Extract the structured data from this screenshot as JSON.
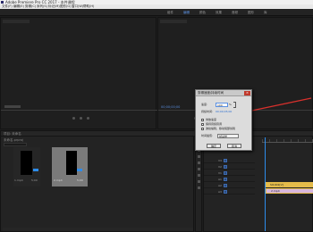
{
  "window": {
    "title": "Adobe Premiere Pro CC 2017 - 本件课程"
  },
  "menu": [
    "文件(F)",
    "编辑(E)",
    "剪辑(C)",
    "序列(S)",
    "标记(M)",
    "图形(G)",
    "窗口(W)",
    "帮助(H)"
  ],
  "workspaces": [
    "组件",
    "编辑",
    "颜色",
    "效果",
    "音频",
    "图形",
    "库"
  ],
  "program_monitor": {
    "timecode": "00;00;00;00"
  },
  "project_panel": {
    "tab_label": "项目: 未命名",
    "file_label": "未命名.prproj",
    "search_placeholder": "",
    "items": [
      {
        "name": "1.mp4",
        "duration": "5;00"
      },
      {
        "name": "2.mp4",
        "duration": "5;00"
      }
    ]
  },
  "timeline": {
    "timecode": "00;00;00;00",
    "clip_labels": [
      "SI1001[V]",
      "2.mp4"
    ],
    "track_labels": [
      "V3",
      "V2",
      "V1",
      "A1",
      "A2",
      "A3"
    ]
  },
  "dialog": {
    "title": "剪辑速度/持续时间",
    "speed_label": "速度:",
    "speed_value": "100",
    "speed_unit": "%",
    "duration_label": "持续时间:",
    "duration_value": "00;00;05;00",
    "reverse_label": "倒放速度",
    "keep_pitch_label": "保持音频音调",
    "ripple_label": "波纹编辑，移动尾部剪辑",
    "interp_label": "时间插值:",
    "interp_value": "帧采样",
    "ok_label": "确定",
    "cancel_label": "取消"
  },
  "colors": {
    "accent": "#2d8ceb",
    "dialog_bg": "#dcdcdc",
    "arrow": "#d9302c",
    "clip": "#e4bb4a"
  }
}
